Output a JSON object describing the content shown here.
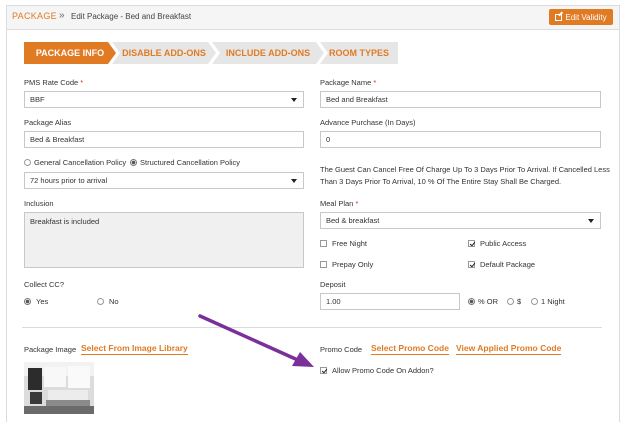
{
  "breadcrumb": {
    "section": "PACKAGE",
    "separator": "»",
    "current": "Edit Package - Bed and Breakfast"
  },
  "header": {
    "edit_validity_label": "Edit Validity"
  },
  "tabs": [
    {
      "label": "PACKAGE INFO",
      "active": true
    },
    {
      "label": "DISABLE ADD-ONS",
      "active": false
    },
    {
      "label": "INCLUDE ADD-ONS",
      "active": false
    },
    {
      "label": "ROOM TYPES",
      "active": false
    }
  ],
  "form": {
    "pms_rate_code": {
      "label": "PMS Rate Code",
      "required_mark": "*",
      "value": "BBF"
    },
    "package_name": {
      "label": "Package Name",
      "required_mark": "*",
      "value": "Bed and Breakfast"
    },
    "package_alias": {
      "label": "Package Alias",
      "value": "Bed & Breakfast"
    },
    "advance_purchase": {
      "label": "Advance Purchase (In Days)",
      "value": "0"
    },
    "cancellation": {
      "general_label": "General Cancellation Policy",
      "structured_label": "Structured Cancellation Policy",
      "selected": "structured",
      "policy_value": "72 hours prior to arrival",
      "info_text": "The Guest Can Cancel Free Of Charge Up To 3 Days Prior To Arrival. If Cancelled Less Than 3 Days Prior To Arrival, 10 % Of The Entire Stay Shall Be Charged."
    },
    "inclusion": {
      "label": "Inclusion",
      "value": "Breakfast is included"
    },
    "meal_plan": {
      "label": "Meal Plan",
      "required_mark": "*",
      "value": "Bed & breakfast"
    },
    "checkboxes": {
      "free_night": {
        "label": "Free Night",
        "checked": false
      },
      "public_access": {
        "label": "Public Access",
        "checked": true
      },
      "prepay_only": {
        "label": "Prepay Only",
        "checked": false
      },
      "default_package": {
        "label": "Default Package",
        "checked": true
      }
    },
    "collect_cc": {
      "label": "Collect CC?",
      "yes_label": "Yes",
      "no_label": "No",
      "selected": "yes"
    },
    "deposit": {
      "label": "Deposit",
      "value": "1.00",
      "options": [
        "% OR",
        "$",
        "1 Night"
      ],
      "selected": "% OR"
    },
    "package_image": {
      "label": "Package Image",
      "link": "Select From Image Library"
    },
    "promo": {
      "label": "Promo Code",
      "select_link": "Select Promo Code",
      "view_link": "View Applied Promo Code",
      "allow_addon_label": "Allow Promo Code On Addon?",
      "allow_addon_checked": true
    }
  },
  "colors": {
    "accent": "#e07b24",
    "tab_inactive": "#e6e6e6",
    "arrow": "#7a2f9b"
  }
}
